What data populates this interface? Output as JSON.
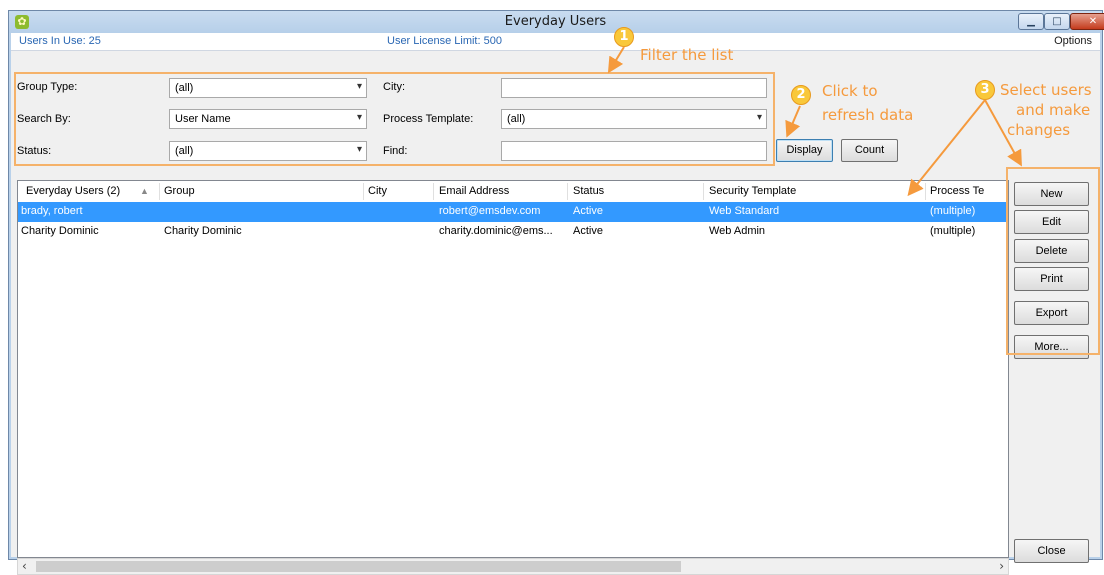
{
  "window": {
    "title": "Everyday Users"
  },
  "info": {
    "in_use": "Users In Use: 25",
    "license": "User License Limit: 500",
    "options": "Options"
  },
  "filters": {
    "group_type_label": "Group Type:",
    "group_type_value": "(all)",
    "search_by_label": "Search By:",
    "search_by_value": "User Name",
    "status_label": "Status:",
    "status_value": "(all)",
    "city_label": "City:",
    "city_value": "",
    "process_template_label": "Process Template:",
    "process_template_value": "(all)",
    "find_label": "Find:",
    "find_value": ""
  },
  "actions": {
    "display": "Display",
    "count": "Count"
  },
  "grid": {
    "columns": [
      "Everyday Users (2)",
      "Group",
      "City",
      "Email Address",
      "Status",
      "Security Template",
      "Process Te"
    ],
    "sorted_column": "Everyday Users (2)",
    "rows": [
      {
        "name": "brady, robert",
        "group": "",
        "city": "",
        "email": "robert@emsdev.com",
        "status": "Active",
        "security": "Web Standard",
        "process": "(multiple)",
        "selected": true
      },
      {
        "name": "Charity Dominic",
        "group": "Charity Dominic",
        "city": "",
        "email": "charity.dominic@ems...",
        "status": "Active",
        "security": "Web Admin",
        "process": "(multiple)",
        "selected": false
      }
    ]
  },
  "side_buttons": {
    "new": "New",
    "edit": "Edit",
    "delete": "Delete",
    "print": "Print",
    "export": "Export",
    "more": "More...",
    "close": "Close"
  },
  "callouts": {
    "one": {
      "num": "1",
      "text": "Filter the list"
    },
    "two": {
      "num": "2",
      "line1": "Click to",
      "line2": "refresh data"
    },
    "three": {
      "num": "3",
      "line1": "Select users",
      "line2": "and make",
      "line3": "changes"
    }
  },
  "colors": {
    "accent": "#f59a3d",
    "selection": "#3399ff",
    "link": "#2a67b3",
    "titlebar": "#b9d1ea"
  },
  "icons": [
    "app-icon",
    "minimize-icon",
    "maximize-icon",
    "close-icon",
    "dropdown-arrow-icon",
    "sort-ascending-icon",
    "scroll-left-icon",
    "scroll-right-icon"
  ]
}
